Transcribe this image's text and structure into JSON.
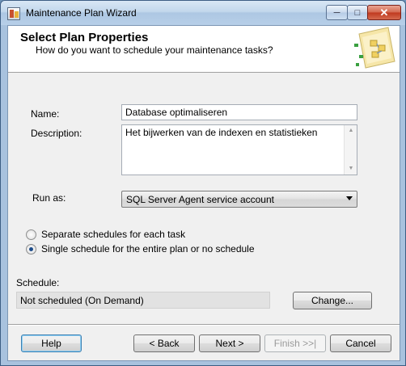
{
  "window": {
    "title": "Maintenance Plan Wizard"
  },
  "header": {
    "title": "Select Plan Properties",
    "subtitle": "How do you want to schedule your maintenance tasks?"
  },
  "form": {
    "name_label": "Name:",
    "name_value": "Database optimaliseren",
    "description_label": "Description:",
    "description_value": "Het bijwerken van de indexen en statistieken",
    "run_as_label": "Run as:",
    "run_as_value": "SQL Server Agent service account",
    "radio_separate_label": "Separate schedules for each task",
    "radio_separate_checked": false,
    "radio_single_label": "Single schedule for the entire plan or no schedule",
    "radio_single_checked": true,
    "schedule_label": "Schedule:",
    "schedule_value": "Not scheduled (On Demand)",
    "change_button": "Change..."
  },
  "footer": {
    "help_button": "Help",
    "back_button": "< Back",
    "next_button": "Next >",
    "finish_button": "Finish >>|",
    "cancel_button": "Cancel"
  },
  "colors": {
    "accent": "#1d4c8a",
    "titlebar": "#bcd3ea"
  }
}
